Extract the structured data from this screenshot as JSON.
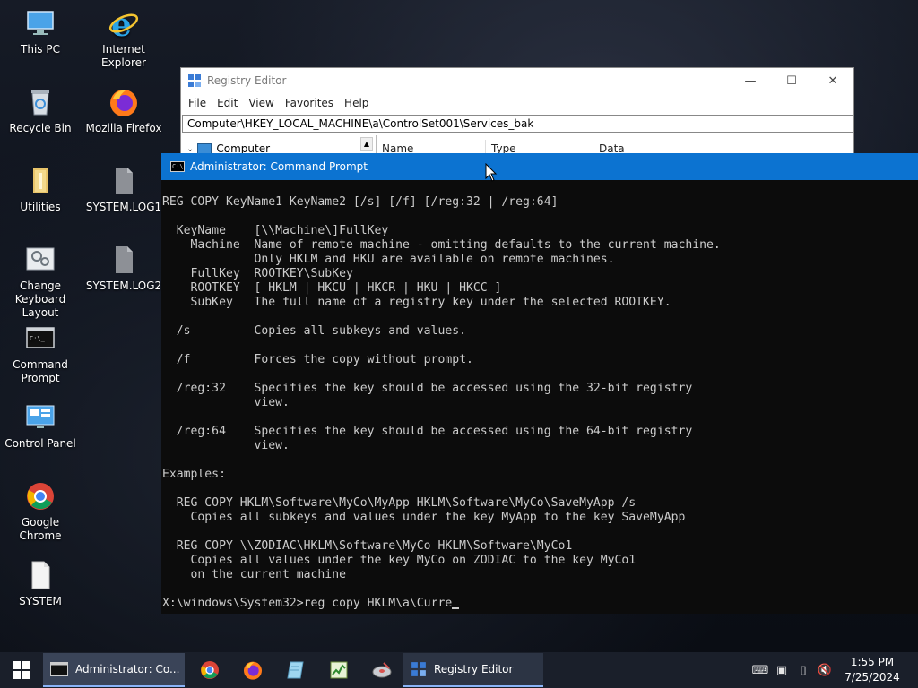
{
  "desktop": {
    "icons": [
      {
        "label": "This PC"
      },
      {
        "label": "Internet Explorer"
      },
      {
        "label": "Recycle Bin"
      },
      {
        "label": "Mozilla Firefox"
      },
      {
        "label": "Utilities"
      },
      {
        "label": "SYSTEM.LOG1"
      },
      {
        "label": "Change Keyboard Layout"
      },
      {
        "label": "SYSTEM.LOG2"
      },
      {
        "label": "Command Prompt"
      },
      {
        "label": "Control Panel"
      },
      {
        "label": "Google Chrome"
      },
      {
        "label": "SYSTEM"
      }
    ]
  },
  "regedit": {
    "title": "Registry Editor",
    "menu": [
      "File",
      "Edit",
      "View",
      "Favorites",
      "Help"
    ],
    "address": "Computer\\HKEY_LOCAL_MACHINE\\a\\ControlSet001\\Services_bak",
    "tree_root": "Computer",
    "columns": [
      "Name",
      "Type",
      "Data"
    ],
    "minimize": "—",
    "maximize": "☐",
    "close": "✕"
  },
  "cmd": {
    "title": "Administrator: Command Prompt",
    "lines": [
      "REG COPY KeyName1 KeyName2 [/s] [/f] [/reg:32 | /reg:64]",
      "",
      "  KeyName    [\\\\Machine\\]FullKey",
      "    Machine  Name of remote machine - omitting defaults to the current machine.",
      "             Only HKLM and HKU are available on remote machines.",
      "    FullKey  ROOTKEY\\SubKey",
      "    ROOTKEY  [ HKLM | HKCU | HKCR | HKU | HKCC ]",
      "    SubKey   The full name of a registry key under the selected ROOTKEY.",
      "",
      "  /s         Copies all subkeys and values.",
      "",
      "  /f         Forces the copy without prompt.",
      "",
      "  /reg:32    Specifies the key should be accessed using the 32-bit registry",
      "             view.",
      "",
      "  /reg:64    Specifies the key should be accessed using the 64-bit registry",
      "             view.",
      "",
      "Examples:",
      "",
      "  REG COPY HKLM\\Software\\MyCo\\MyApp HKLM\\Software\\MyCo\\SaveMyApp /s",
      "    Copies all subkeys and values under the key MyApp to the key SaveMyApp",
      "",
      "  REG COPY \\\\ZODIAC\\HKLM\\Software\\MyCo HKLM\\Software\\MyCo1",
      "    Copies all values under the key MyCo on ZODIAC to the key MyCo1",
      "    on the current machine",
      ""
    ],
    "prompt": "X:\\windows\\System32>",
    "input": "reg copy HKLM\\a\\Curre"
  },
  "taskbar": {
    "tasks": [
      {
        "label": "Administrator: Co..."
      },
      {
        "label": "Registry Editor"
      }
    ],
    "clock": {
      "time": "1:55 PM",
      "date": "7/25/2024"
    }
  }
}
